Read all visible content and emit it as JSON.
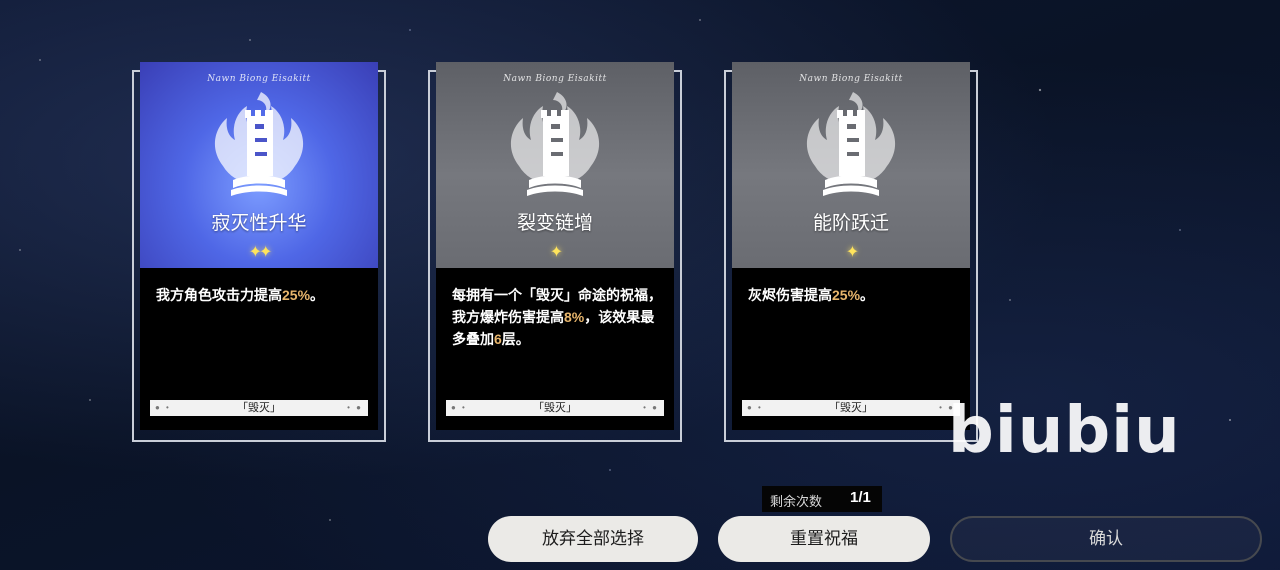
{
  "cards": [
    {
      "tribe": "Nawn Biong Eisakitt",
      "name": "寂灭性升华",
      "stars": "✦✦",
      "desc_parts": [
        "我方角色攻击力提高",
        "25%",
        "。"
      ],
      "path": "「毁灭」",
      "state": "selected"
    },
    {
      "tribe": "Nawn Biong Eisakitt",
      "name": "裂变链增",
      "stars": "✦",
      "desc_parts": [
        "每拥有一个「毁灭」命途的祝福，我方爆炸伤害提高",
        "8%",
        "，该效果最多叠加",
        "6",
        "层。"
      ],
      "path": "「毁灭」",
      "state": "normal"
    },
    {
      "tribe": "Nawn Biong Eisakitt",
      "name": "能阶跃迁",
      "stars": "✦",
      "desc_parts": [
        "灰烬伤害提高",
        "25%",
        "。"
      ],
      "path": "「毁灭」",
      "state": "normal"
    }
  ],
  "remaining": {
    "label": "剩余次数",
    "value": "1/1"
  },
  "buttons": {
    "abandon": "放弃全部选择",
    "reset": "重置祝福",
    "confirm": "确认"
  },
  "watermark": "biubiu",
  "colors": {
    "highlight": "#e7b56c",
    "selected_bg": "#4f67e6",
    "card_gray": "#6a6c72"
  }
}
